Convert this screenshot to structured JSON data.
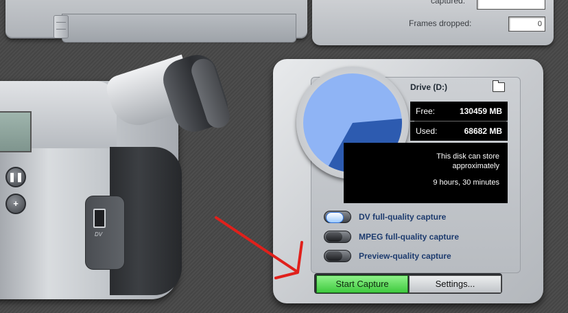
{
  "top_stats": {
    "captured_label": "captured:",
    "captured_value": "",
    "frames_dropped_label": "Frames dropped:",
    "frames_dropped_value": "0"
  },
  "camcorder": {
    "pause_icon": "pause-icon",
    "plus_icon": "plus-icon",
    "dv_label": "DV"
  },
  "drive": {
    "name": "Drive (D:)",
    "free_label": "Free:",
    "free_value": "130459 MB",
    "used_label": "Used:",
    "used_value": "68682 MB",
    "free_mb": 130459,
    "used_mb": 68682,
    "info_line1": "This disk can store",
    "info_line2": "approximately",
    "info_line3": "9 hours, 30 minutes",
    "free_color": "#8fb4f5",
    "used_color": "#2d5bb0"
  },
  "capture_options": [
    {
      "label": "DV full-quality capture",
      "selected": true
    },
    {
      "label": "MPEG full-quality capture",
      "selected": false
    },
    {
      "label": "Preview-quality capture",
      "selected": false
    }
  ],
  "buttons": {
    "start_capture": "Start Capture",
    "settings": "Settings..."
  },
  "colors": {
    "accent_green": "#4fd44f",
    "annotation_arrow": "#e0201b"
  }
}
